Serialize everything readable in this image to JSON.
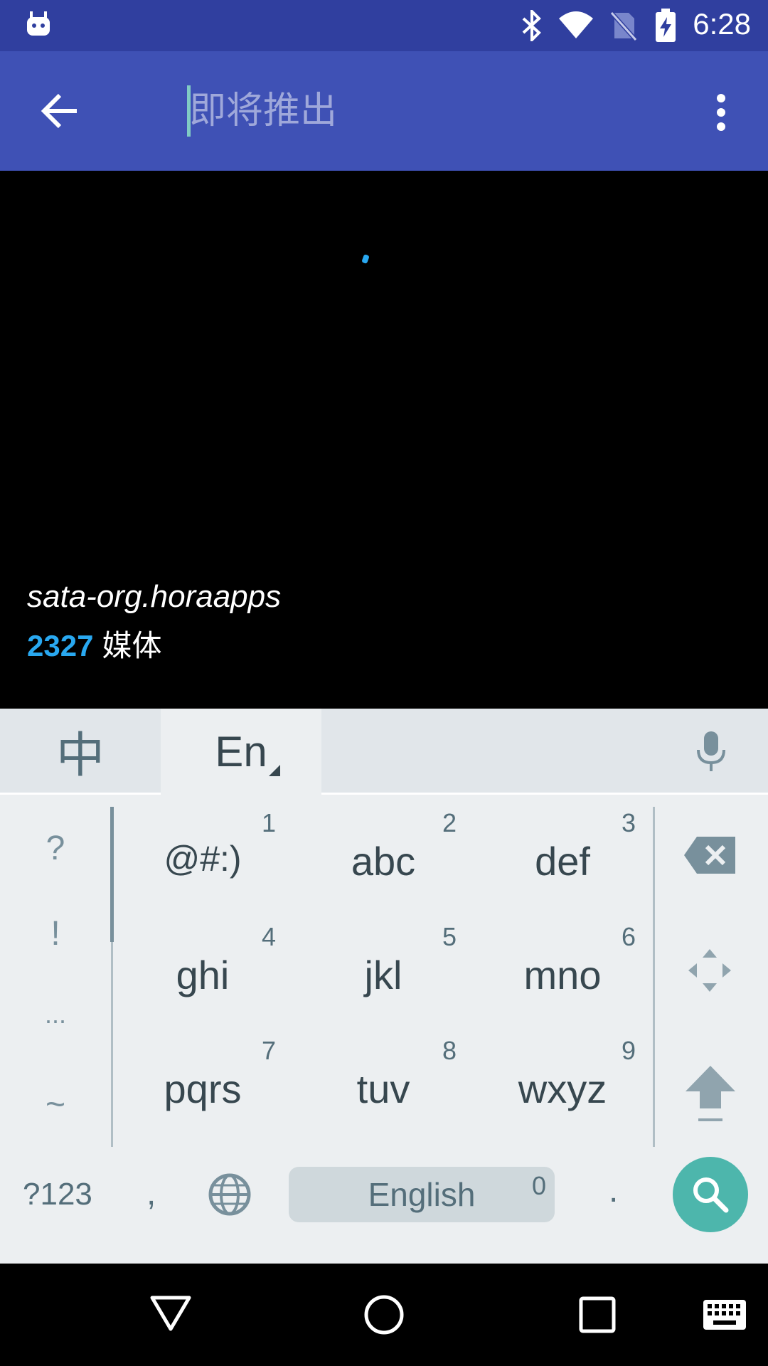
{
  "status_bar": {
    "time": "6:28"
  },
  "app_bar": {
    "search_placeholder": "即将推出"
  },
  "content": {
    "app_name": "sata-org.horaapps",
    "count": "2327",
    "count_label": "媒体"
  },
  "keyboard": {
    "tab_zh": "中",
    "tab_en": "En",
    "symbols": [
      "?",
      "!",
      "...",
      "~"
    ],
    "keys": [
      {
        "label": "@#:)",
        "number": "1"
      },
      {
        "label": "abc",
        "number": "2"
      },
      {
        "label": "def",
        "number": "3"
      },
      {
        "label": "ghi",
        "number": "4"
      },
      {
        "label": "jkl",
        "number": "5"
      },
      {
        "label": "mno",
        "number": "6"
      },
      {
        "label": "pqrs",
        "number": "7"
      },
      {
        "label": "tuv",
        "number": "8"
      },
      {
        "label": "wxyz",
        "number": "9"
      }
    ],
    "symbols_key": "?123",
    "comma_key": ",",
    "space_label": "English",
    "space_number": "0",
    "period_key": "."
  },
  "colors": {
    "status_bar": "#303F9F",
    "app_bar": "#3F51B5",
    "accent": "#29A8F0",
    "search_key": "#4DB6AC"
  }
}
